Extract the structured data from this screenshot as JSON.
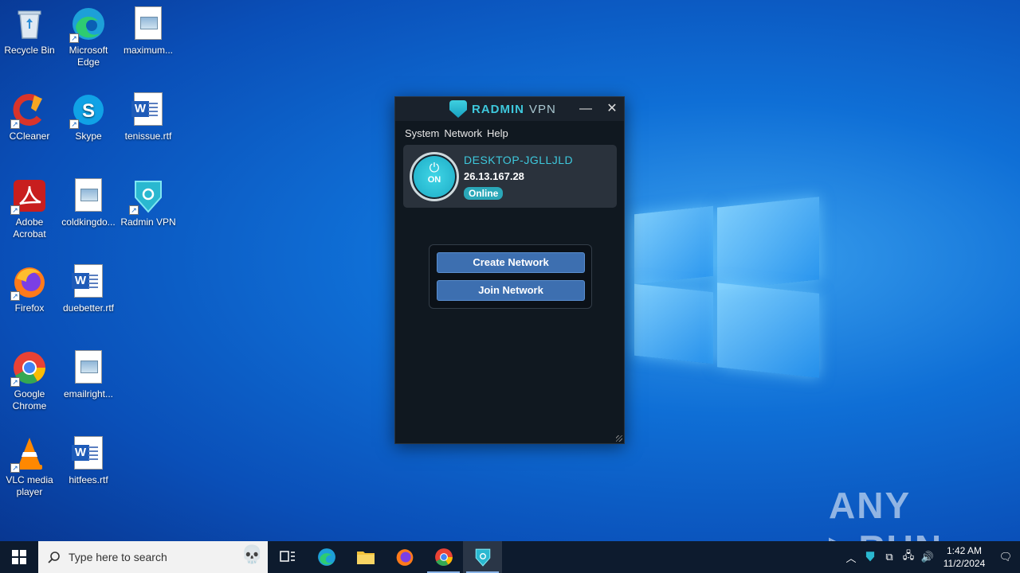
{
  "desktop": {
    "icons": [
      {
        "label": "Recycle Bin"
      },
      {
        "label": "Microsoft Edge"
      },
      {
        "label": "maximum..."
      },
      {
        "label": "CCleaner"
      },
      {
        "label": "Skype"
      },
      {
        "label": "tenissue.rtf"
      },
      {
        "label": "Adobe Acrobat"
      },
      {
        "label": "coldkingdo..."
      },
      {
        "label": "Radmin VPN"
      },
      {
        "label": "Firefox"
      },
      {
        "label": "duebetter.rtf"
      },
      {
        "label": "Google Chrome"
      },
      {
        "label": "emailright..."
      },
      {
        "label": "VLC media player"
      },
      {
        "label": "hitfees.rtf"
      }
    ]
  },
  "radmin": {
    "brand_main": "RADMIN",
    "brand_sub": "VPN",
    "menu": [
      "System",
      "Network",
      "Help"
    ],
    "pc_name": "DESKTOP-JGLLJLD",
    "ip": "26.13.167.28",
    "status": "Online",
    "power_label": "ON",
    "create_button": "Create Network",
    "join_button": "Join Network",
    "accent": "#3ec8dc"
  },
  "taskbar": {
    "search_placeholder": "Type here to search",
    "time": "1:42 AM",
    "date": "11/2/2024"
  },
  "watermark": "ANY RUN"
}
